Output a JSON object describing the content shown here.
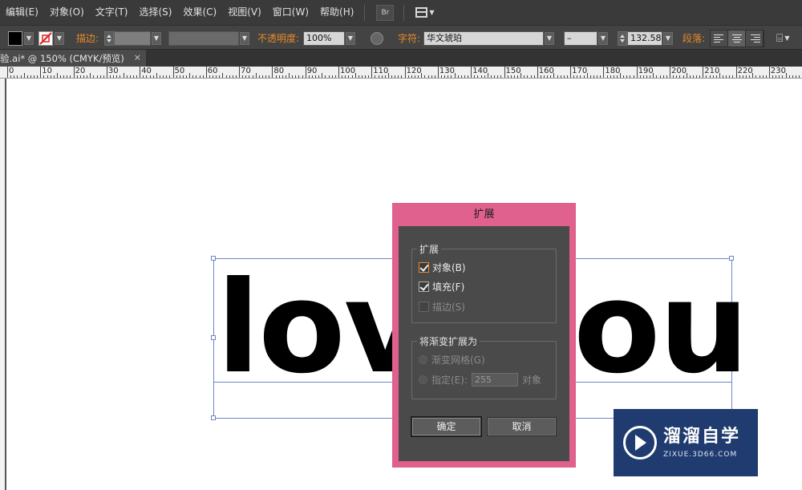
{
  "menubar": {
    "items": [
      "编辑(E)",
      "对象(O)",
      "文字(T)",
      "选择(S)",
      "效果(C)",
      "视图(V)",
      "窗口(W)",
      "帮助(H)"
    ],
    "bridge_label": "Br"
  },
  "controlbar": {
    "stroke_label": "描边:",
    "opacity_label": "不透明度:",
    "opacity_value": "100%",
    "char_label": "字符:",
    "font_name": "华文琥珀",
    "font_style": "–",
    "font_size": "132.58",
    "para_label": "段落:"
  },
  "tab": {
    "title": "验.ai* @ 150% (CMYK/预览)",
    "close": "×"
  },
  "ruler": {
    "labels": [
      "0",
      "10",
      "20",
      "30",
      "40",
      "50",
      "60",
      "70",
      "80",
      "90",
      "100",
      "110",
      "120",
      "130",
      "140",
      "150",
      "160",
      "170",
      "180",
      "190",
      "200",
      "210",
      "220",
      "230"
    ]
  },
  "artwork": {
    "left_text": "lov",
    "right_text": "ou"
  },
  "dialog": {
    "title": "扩展",
    "group1": {
      "legend": "扩展",
      "object_label": "对象(B)",
      "object_checked": true,
      "fill_label": "填充(F)",
      "fill_checked": true,
      "stroke_label": "描边(S)",
      "stroke_checked": false
    },
    "group2": {
      "legend": "将渐变扩展为",
      "mesh_label": "渐变网格(G)",
      "specify_label": "指定(E):",
      "specify_value": "255",
      "objects_suffix": "对象"
    },
    "ok_label": "确定",
    "cancel_label": "取消"
  },
  "watermark": {
    "title": "溜溜自学",
    "subtitle": "ZIXUE.3D66.COM"
  }
}
